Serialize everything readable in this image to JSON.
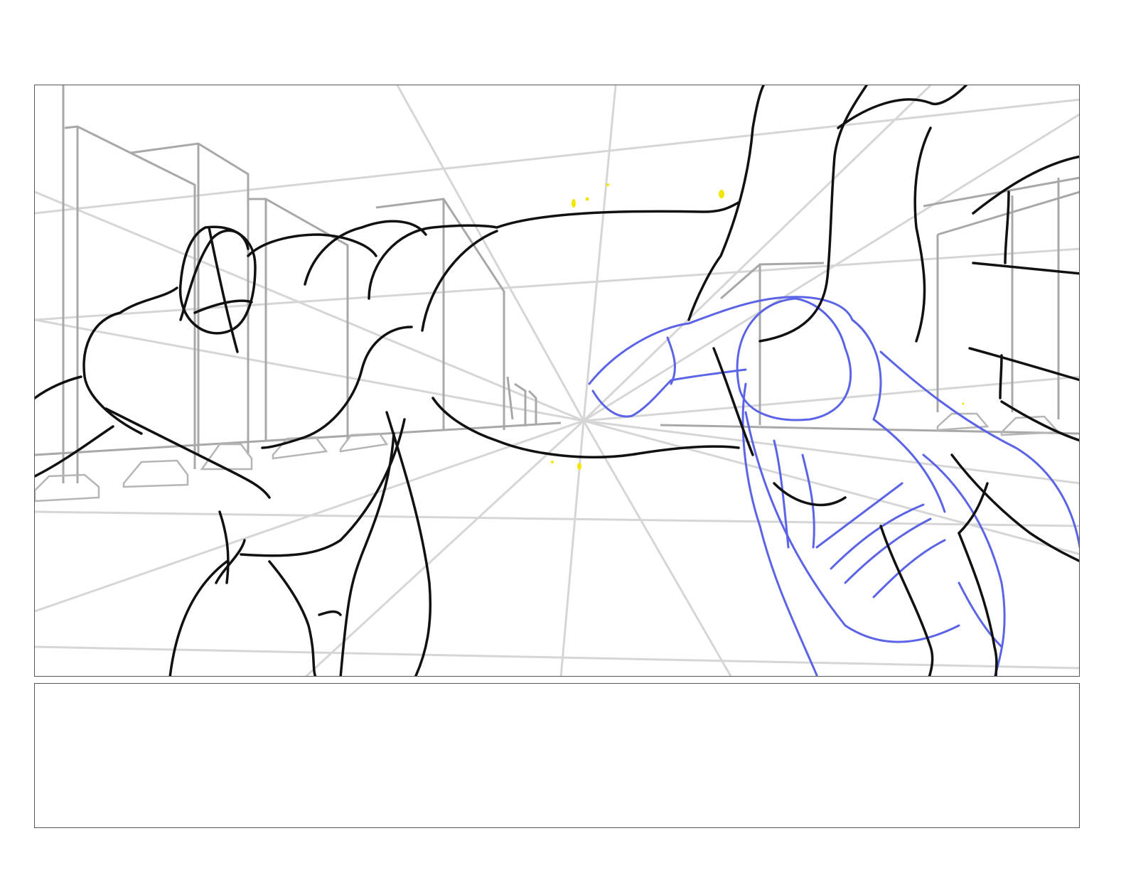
{
  "storyboard": {
    "caption": "",
    "colors": {
      "background": "#ffffff",
      "panel_border": "#555555",
      "perspective_guides": "#d6d6d6",
      "buildings": "#a8a8a8",
      "ink": "#111111",
      "rough_sketch": "#5b63e6",
      "highlight": "#f2e600"
    }
  }
}
